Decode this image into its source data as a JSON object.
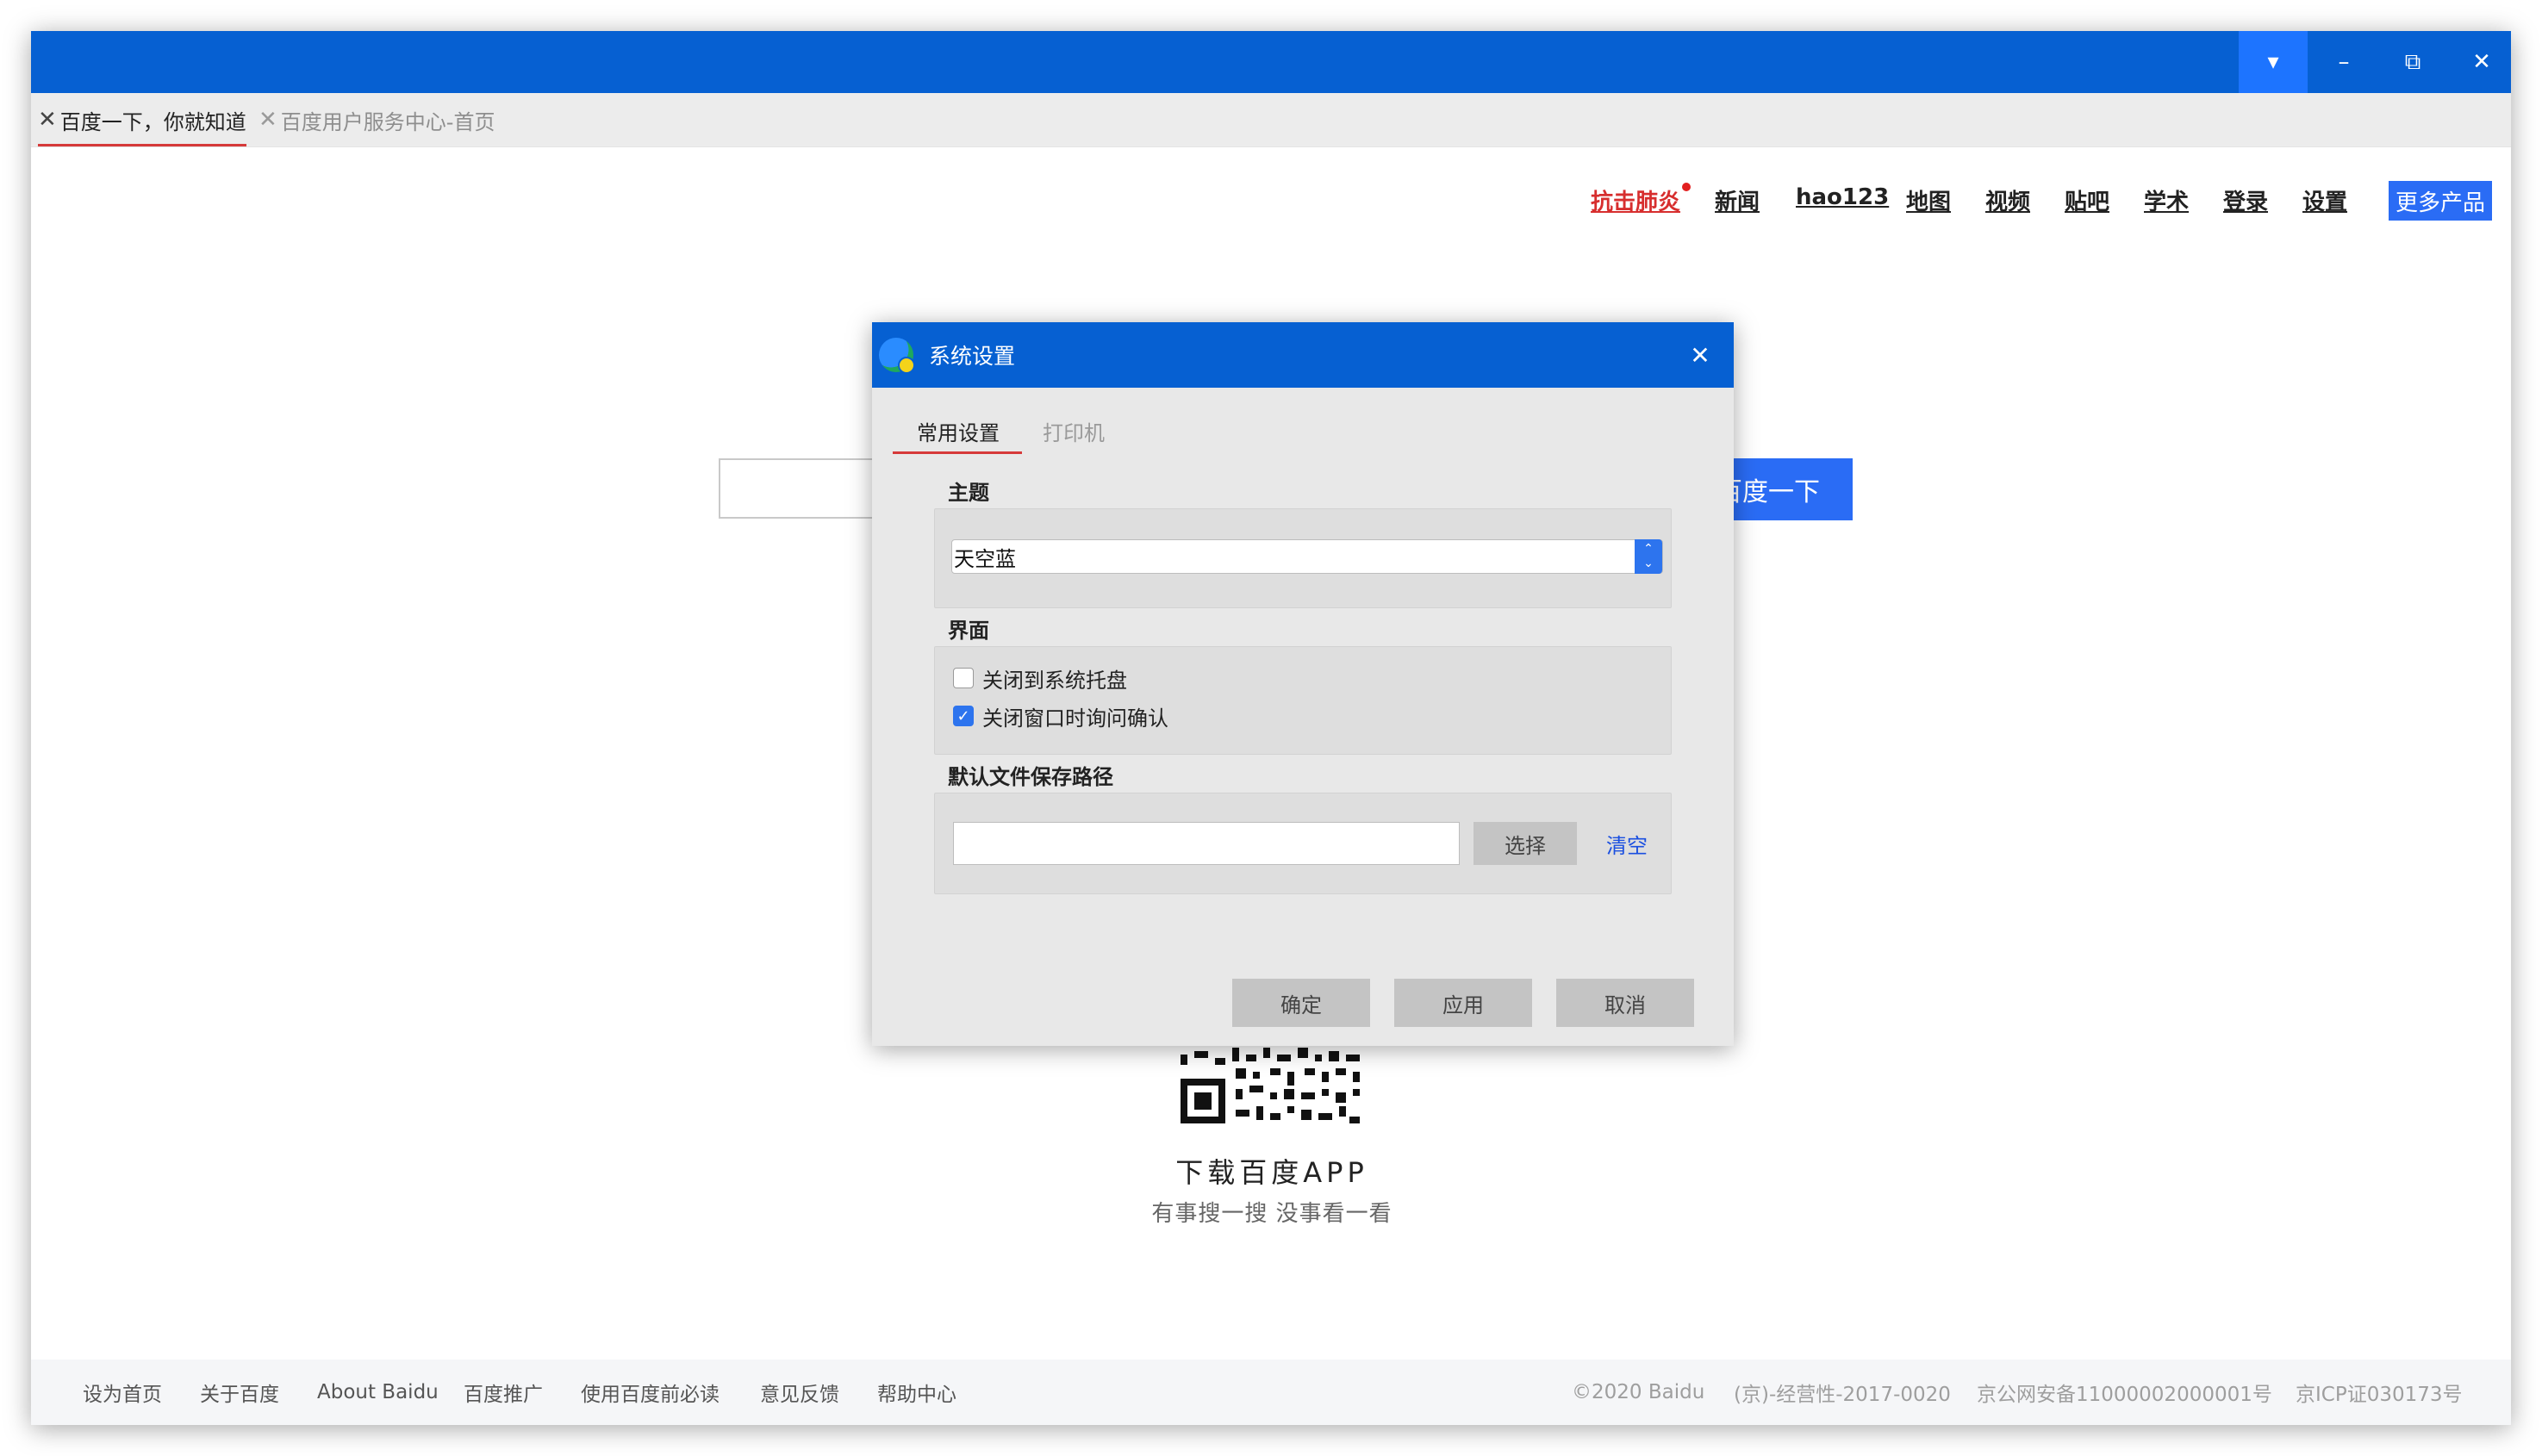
{
  "browser": {
    "tabs": [
      {
        "label": "百度一下，你就知道",
        "active": true
      },
      {
        "label": "百度用户服务中心-首页",
        "active": false
      }
    ],
    "controls": {
      "dropdown": "▾",
      "minimize": "–",
      "restore": "⧉",
      "close": "✕"
    }
  },
  "baidu": {
    "nav": [
      "抗击肺炎",
      "新闻",
      "hao123",
      "地图",
      "视频",
      "贴吧",
      "学术",
      "登录",
      "设置"
    ],
    "more_products": "更多产品",
    "search_button": "百度一下",
    "app_title": "下载百度APP",
    "app_subtitle": "有事搜一搜  没事看一看",
    "footer_left": [
      "设为首页",
      "关于百度",
      "About Baidu",
      "百度推广",
      "使用百度前必读",
      "意见反馈",
      "帮助中心"
    ],
    "footer_right": [
      "©2020 Baidu",
      "(京)-经营性-2017-0020",
      "京公网安备11000002000001号",
      "京ICP证030173号"
    ]
  },
  "dialog": {
    "title": "系统设置",
    "close": "✕",
    "tabs": [
      "常用设置",
      "打印机"
    ],
    "theme_label": "主题",
    "theme_value": "天空蓝",
    "interface_label": "界面",
    "checkboxes": [
      {
        "label": "关闭到系统托盘",
        "checked": false
      },
      {
        "label": "关闭窗口时询问确认",
        "checked": true
      }
    ],
    "path_label": "默认文件保存路径",
    "path_value": "",
    "choose_button": "选择",
    "clear_link": "清空",
    "buttons": {
      "ok": "确定",
      "apply": "应用",
      "cancel": "取消"
    }
  },
  "colors": {
    "titlebar": "#0660d2",
    "accent": "#2a6cf5",
    "tab_underline": "#d63a3a",
    "hot_red": "#d72e2e"
  }
}
